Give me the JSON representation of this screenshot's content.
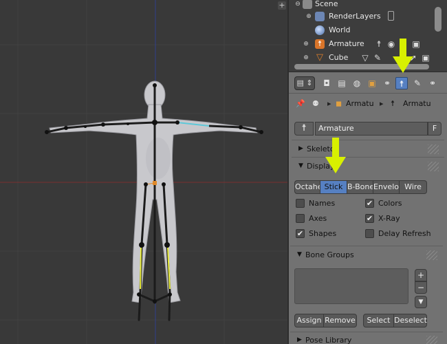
{
  "viewport": {
    "corner_label": "+"
  },
  "outliner": {
    "rows": [
      {
        "label": "Scene"
      },
      {
        "label": "RenderLayers"
      },
      {
        "label": "World"
      },
      {
        "label": "Armature"
      },
      {
        "label": "Cube"
      }
    ]
  },
  "header": {
    "menu_icon": "properties-menu-icon"
  },
  "context_tabs": [
    {
      "name": "render-icon"
    },
    {
      "name": "render-layers-icon"
    },
    {
      "name": "world-icon"
    },
    {
      "name": "object-icon"
    },
    {
      "name": "constraints-icon"
    },
    {
      "name": "armature-data-icon",
      "active": true
    },
    {
      "name": "bone-icon"
    },
    {
      "name": "bone-constraints-icon"
    }
  ],
  "breadcrumb": {
    "object": "Armatu",
    "data": "Armatu"
  },
  "name_field": {
    "value": "Armature",
    "fake_user": "F"
  },
  "panels": {
    "skeleton": "Skeleton",
    "display": "Display",
    "bone_groups": "Bone Groups",
    "pose_library": "Pose Library"
  },
  "display": {
    "modes": [
      "Octahe",
      "Stick",
      "B-Bone",
      "Envelo",
      "Wire"
    ],
    "active_mode": "Stick",
    "options": [
      {
        "label": "Names",
        "checked": false
      },
      {
        "label": "Colors",
        "checked": true
      },
      {
        "label": "Axes",
        "checked": false
      },
      {
        "label": "X-Ray",
        "checked": true
      },
      {
        "label": "Shapes",
        "checked": true
      },
      {
        "label": "Delay Refresh",
        "checked": false
      }
    ]
  },
  "bone_groups": {
    "add": "+",
    "remove": "−",
    "menu": "▼",
    "assign": "Assign",
    "remove_btn": "Remove",
    "select": "Select",
    "deselect": "Deselect"
  },
  "colors": {
    "accent": "#5680c2",
    "arrow": "#d8f000",
    "selected_bone": "#5ec8d8",
    "x_axis": "#7a2f2f",
    "y_axis": "#2f3f8a"
  }
}
